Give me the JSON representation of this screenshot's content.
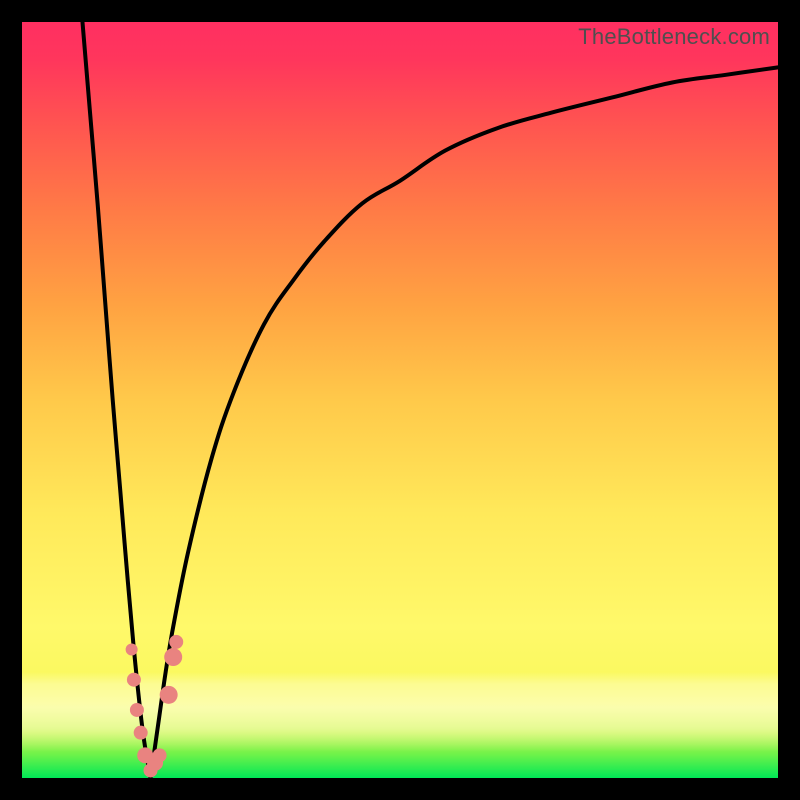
{
  "watermark": "TheBottleneck.com",
  "colors": {
    "frame": "#000000",
    "curve": "#000000",
    "dot": "#e98380",
    "grad_top": "#ff2f61",
    "grad_mid": "#ffe95a",
    "grad_bottom": "#00e756"
  },
  "chart_data": {
    "type": "line",
    "title": "",
    "xlabel": "",
    "ylabel": "",
    "xlim": [
      0,
      100
    ],
    "ylim": [
      0,
      100
    ],
    "vertex_x": 17,
    "series": [
      {
        "name": "left-branch",
        "x": [
          8,
          9,
          10,
          11,
          12,
          13,
          14,
          15,
          16,
          17
        ],
        "y": [
          100,
          88,
          76,
          63,
          50,
          38,
          26,
          15,
          6,
          0
        ]
      },
      {
        "name": "right-branch",
        "x": [
          17,
          18,
          19,
          20,
          22,
          25,
          28,
          32,
          36,
          40,
          45,
          50,
          56,
          63,
          70,
          78,
          86,
          93,
          100
        ],
        "y": [
          0,
          7,
          14,
          20,
          30,
          42,
          51,
          60,
          66,
          71,
          76,
          79,
          83,
          86,
          88,
          90,
          92,
          93,
          94
        ]
      }
    ],
    "dots": [
      {
        "x": 14.5,
        "y": 17,
        "r": 6
      },
      {
        "x": 14.8,
        "y": 13,
        "r": 7
      },
      {
        "x": 15.2,
        "y": 9,
        "r": 7
      },
      {
        "x": 15.7,
        "y": 6,
        "r": 7
      },
      {
        "x": 16.3,
        "y": 3,
        "r": 8
      },
      {
        "x": 17.0,
        "y": 1,
        "r": 7
      },
      {
        "x": 17.6,
        "y": 2,
        "r": 8
      },
      {
        "x": 18.2,
        "y": 3,
        "r": 7
      },
      {
        "x": 19.4,
        "y": 11,
        "r": 9
      },
      {
        "x": 20.0,
        "y": 16,
        "r": 9
      },
      {
        "x": 20.4,
        "y": 18,
        "r": 7
      }
    ]
  }
}
